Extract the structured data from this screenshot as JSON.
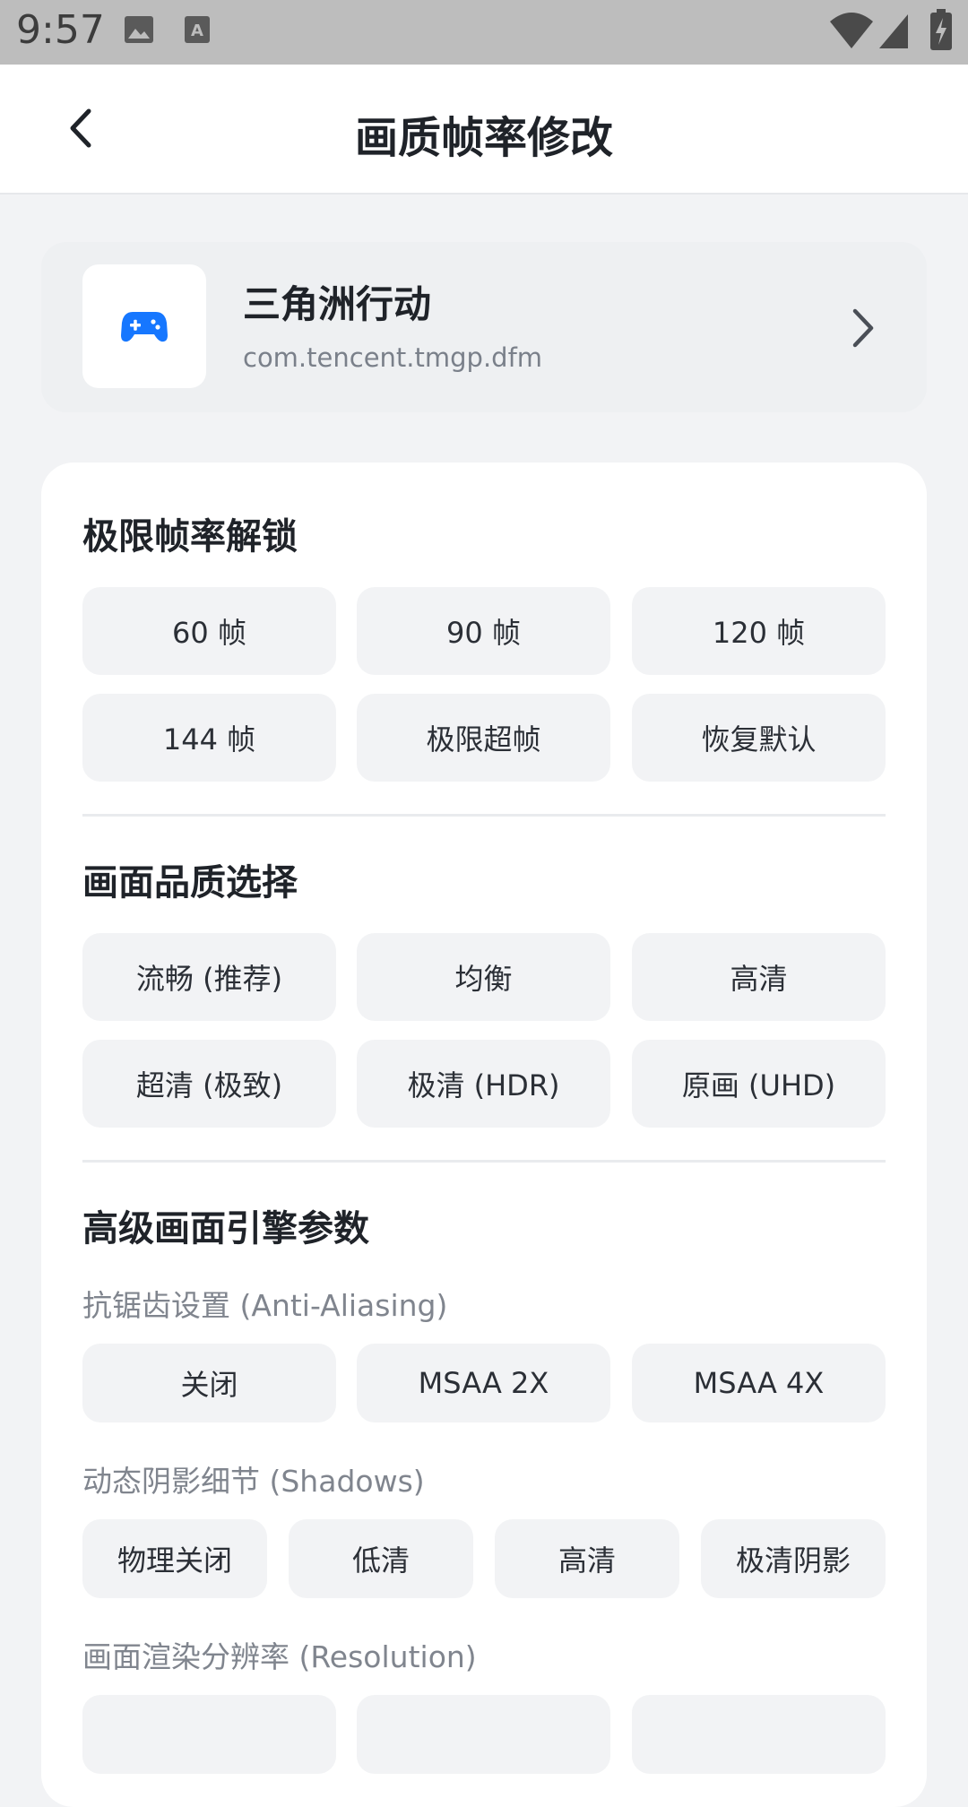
{
  "status_bar": {
    "time": "9:57",
    "icons_left": [
      "image-icon",
      "keyboard-a-icon"
    ],
    "icons_right": [
      "wifi-icon",
      "signal-icon",
      "battery-charging-icon"
    ]
  },
  "app_bar": {
    "title": "画质帧率修改",
    "back_icon": "chevron-left-icon"
  },
  "game": {
    "name": "三角洲行动",
    "package": "com.tencent.tmgp.dfm",
    "icon": "gamepad-icon",
    "icon_color": "#1677FF"
  },
  "frame_rate": {
    "title": "极限帧率解锁",
    "options": [
      "60 帧",
      "90 帧",
      "120 帧",
      "144 帧",
      "极限超帧",
      "恢复默认"
    ]
  },
  "quality": {
    "title": "画面品质选择",
    "options": [
      "流畅 (推荐)",
      "均衡",
      "高清",
      "超清 (极致)",
      "极清 (HDR)",
      "原画 (UHD)"
    ]
  },
  "advanced": {
    "title": "高级画面引擎参数",
    "anti_aliasing": {
      "label": "抗锯齿设置 (Anti-Aliasing)",
      "options": [
        "关闭",
        "MSAA 2X",
        "MSAA 4X"
      ]
    },
    "shadows": {
      "label": "动态阴影细节 (Shadows)",
      "options": [
        "物理关闭",
        "低清",
        "高清",
        "极清阴影"
      ]
    },
    "resolution": {
      "label": "画面渲染分辨率 (Resolution)",
      "options": [
        "",
        "",
        ""
      ]
    }
  }
}
